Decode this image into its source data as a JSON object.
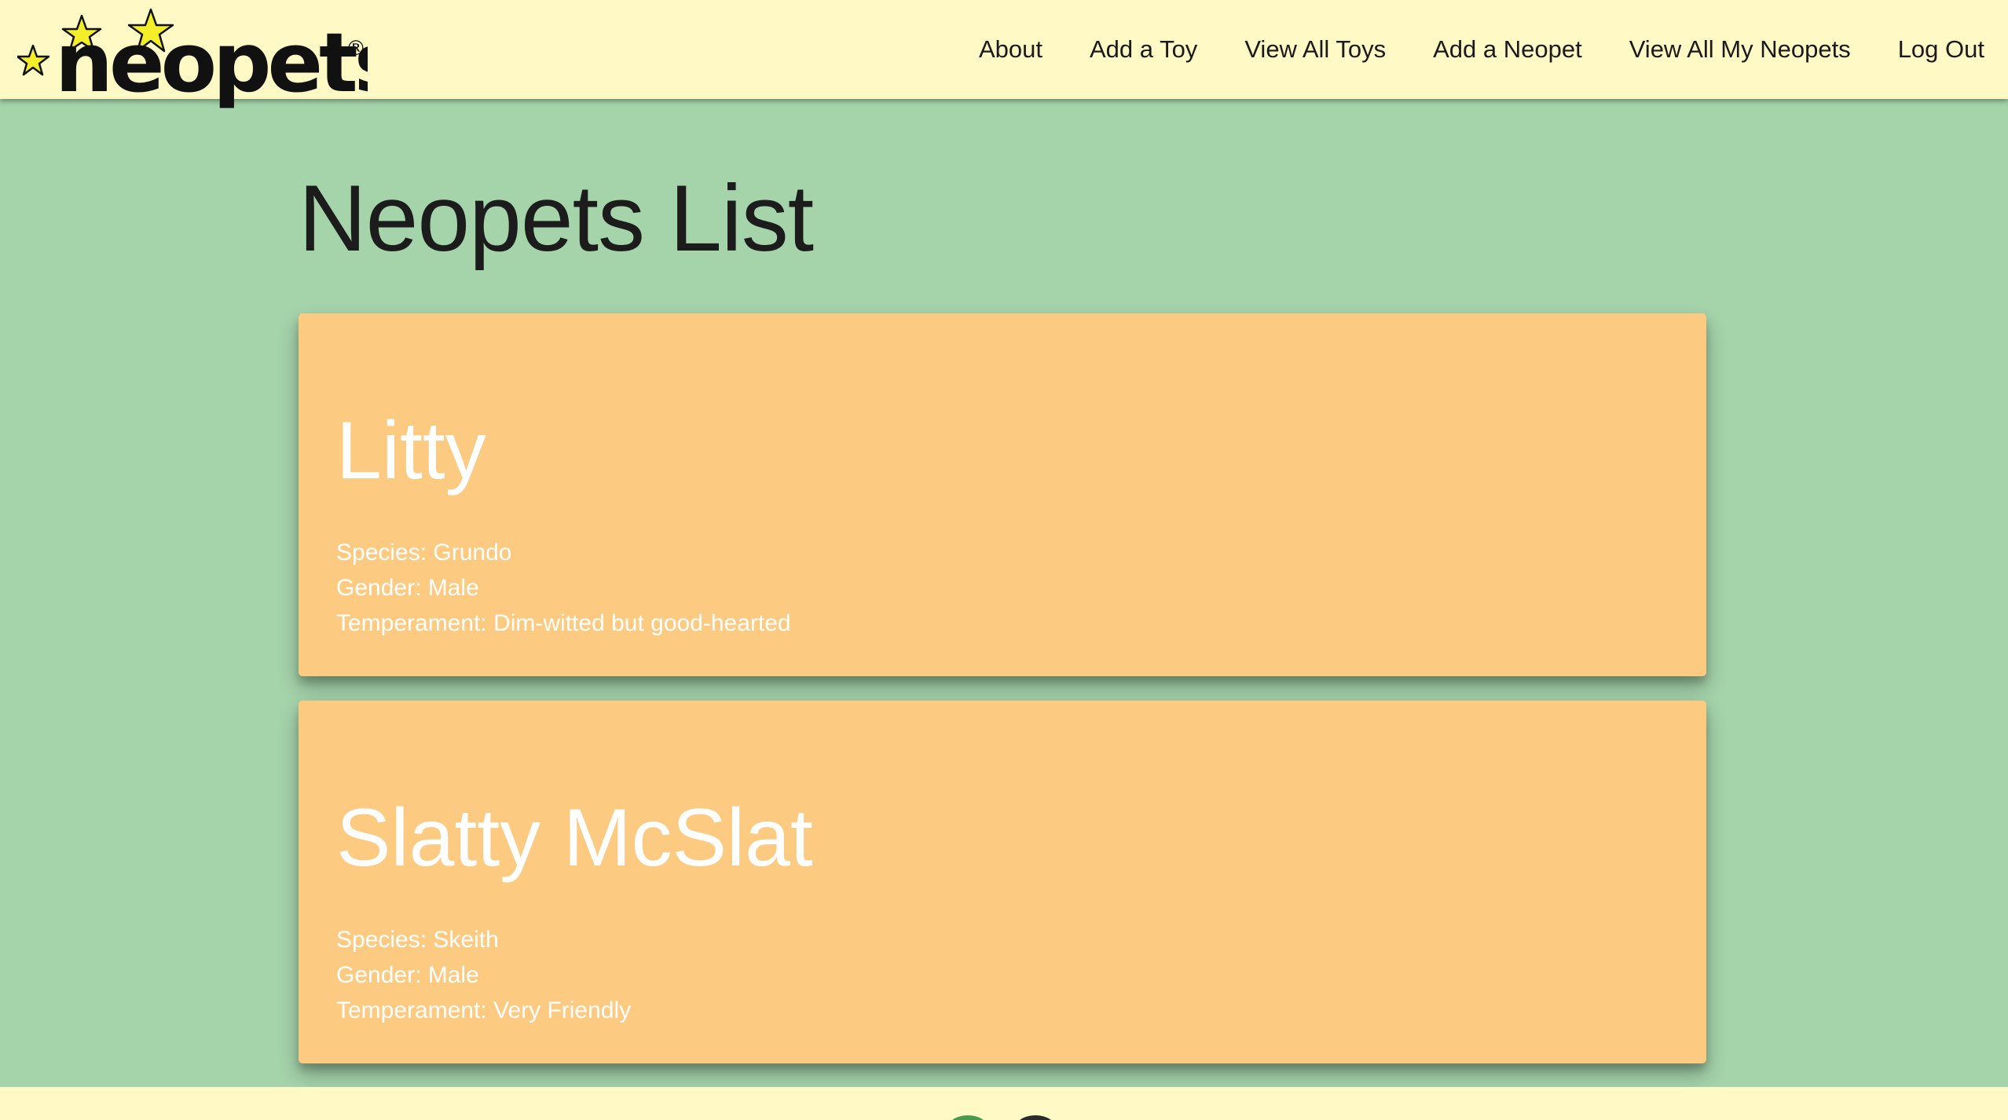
{
  "brand": {
    "logo_text": "neopets",
    "registered_mark": "®",
    "colors": {
      "nav_background": "#fff9c6",
      "page_background": "#a5d3aa",
      "card_background": "#fdca82",
      "star_yellow": "#f3ee28"
    }
  },
  "nav": {
    "links": [
      {
        "label": "About"
      },
      {
        "label": "Add a Toy"
      },
      {
        "label": "View All Toys"
      },
      {
        "label": "Add a Neopet"
      },
      {
        "label": "View All My Neopets"
      },
      {
        "label": "Log Out"
      }
    ]
  },
  "main": {
    "title": "Neopets List",
    "neopets": [
      {
        "name": "Litty",
        "species": "Species: Grundo",
        "gender": "Gender: Male",
        "temperament": "Temperament: Dim-witted but good-hearted"
      },
      {
        "name": "Slatty McSlat",
        "species": "Species: Skeith",
        "gender": "Gender: Male",
        "temperament": "Temperament: Very Friendly"
      }
    ]
  }
}
